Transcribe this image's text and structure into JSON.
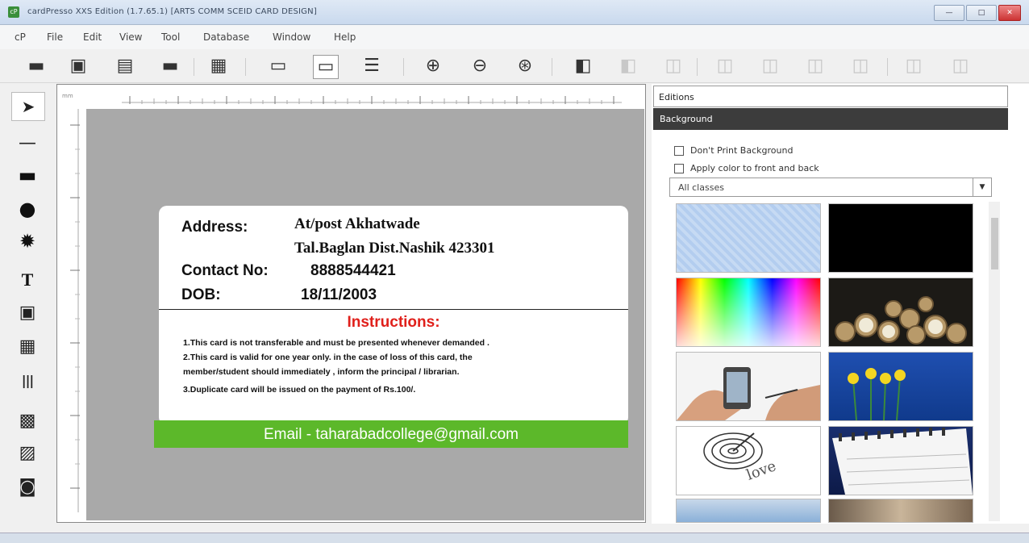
{
  "window": {
    "title": "cardPresso XXS Edition (1.7.65.1) [ARTS COMM SCEID CARD DESIGN]",
    "app_icon": "cP",
    "buttons": {
      "minimize": "—",
      "maximize": "□",
      "close": "✕"
    }
  },
  "menu": [
    "cP",
    "File",
    "Edit",
    "View",
    "Tool",
    "Database",
    "Window",
    "Help"
  ],
  "toolbar": {
    "buttons": [
      {
        "name": "card-new-icon",
        "glyph": "▬",
        "enabled": true
      },
      {
        "name": "printer-open-icon",
        "glyph": "▣",
        "enabled": true
      },
      {
        "name": "save-icon",
        "glyph": "▤",
        "enabled": true
      },
      {
        "name": "card-print-icon",
        "glyph": "▬",
        "enabled": true
      },
      {
        "name": "print-icon",
        "glyph": "▦",
        "enabled": true
      },
      {
        "name": "card-front-icon",
        "glyph": "▭",
        "enabled": true
      },
      {
        "name": "card-back-icon",
        "glyph": "▭",
        "enabled": true,
        "selected": true
      },
      {
        "name": "list-icon",
        "glyph": "☰",
        "enabled": true
      },
      {
        "name": "zoom-in-icon",
        "glyph": "⊕",
        "enabled": true
      },
      {
        "name": "zoom-out-icon",
        "glyph": "⊖",
        "enabled": true
      },
      {
        "name": "zoom-fit-icon",
        "glyph": "⊛",
        "enabled": true
      },
      {
        "name": "arrange-front-icon",
        "glyph": "◧",
        "enabled": true
      },
      {
        "name": "arrange-back-icon",
        "glyph": "◧",
        "enabled": false
      },
      {
        "name": "align-icon",
        "glyph": "◫",
        "enabled": false
      },
      {
        "name": "align-left-icon",
        "glyph": "◫",
        "enabled": false
      },
      {
        "name": "align-center-icon",
        "glyph": "◫",
        "enabled": false
      },
      {
        "name": "align-right-icon",
        "glyph": "◫",
        "enabled": false
      },
      {
        "name": "align-top-icon",
        "glyph": "◫",
        "enabled": false
      },
      {
        "name": "align-middle-icon",
        "glyph": "◫",
        "enabled": false
      },
      {
        "name": "align-bottom-icon",
        "glyph": "◫",
        "enabled": false
      }
    ]
  },
  "tools": [
    {
      "name": "select-arrow-icon",
      "glyph": "➤"
    },
    {
      "name": "line-tool-icon",
      "glyph": "—"
    },
    {
      "name": "rectangle-tool-icon",
      "glyph": "▬"
    },
    {
      "name": "ellipse-tool-icon",
      "glyph": "●"
    },
    {
      "name": "star-tool-icon",
      "glyph": "✹"
    },
    {
      "name": "text-tool-icon",
      "glyph": "T"
    },
    {
      "name": "qrcode-tool-icon",
      "glyph": "▣"
    },
    {
      "name": "calendar-tool-icon",
      "glyph": "▦"
    },
    {
      "name": "barcode-tool-icon",
      "glyph": "|||"
    },
    {
      "name": "image-tool-icon",
      "glyph": "▩"
    },
    {
      "name": "picture-tool-icon",
      "glyph": "▨"
    },
    {
      "name": "camera-tool-icon",
      "glyph": "◙"
    }
  ],
  "ruler": {
    "unit": "mm"
  },
  "card": {
    "address_label": "Address:",
    "address_line1": "At/post Akhatwade",
    "address_line2": "Tal.Baglan Dist.Nashik 423301",
    "contact_label": "Contact No:",
    "contact_value": "8888544421",
    "dob_label": "DOB:",
    "dob_value": "18/11/2003",
    "instructions_title": "Instructions:",
    "rule1": "1.This card is not transferable and must be presented whenever demanded .",
    "rule2a": "2.This card is valid for one year only. in the case of loss of this card, the",
    "rule2b": "member/student should immediately , inform the principal / librarian.",
    "rule3": "3.Duplicate card will be issued on the payment of      Rs.100/.",
    "email": "Email - taharabadcollege@gmail.com",
    "colors": {
      "instructions": "#e0201b",
      "email_bar": "#5cb82a"
    }
  },
  "panel": {
    "editions_label": "Editions",
    "background_label": "Background",
    "option1": "Don't Print Background",
    "option2": "Apply color to front and back",
    "class_select": "All classes"
  },
  "thumbnails": [
    "transparent-pattern",
    "black",
    "color-spectrum",
    "clocks",
    "hand-phone",
    "yellow-flowers",
    "love-target",
    "calendar-pages",
    "sky-clouds",
    "ruler-coins"
  ]
}
